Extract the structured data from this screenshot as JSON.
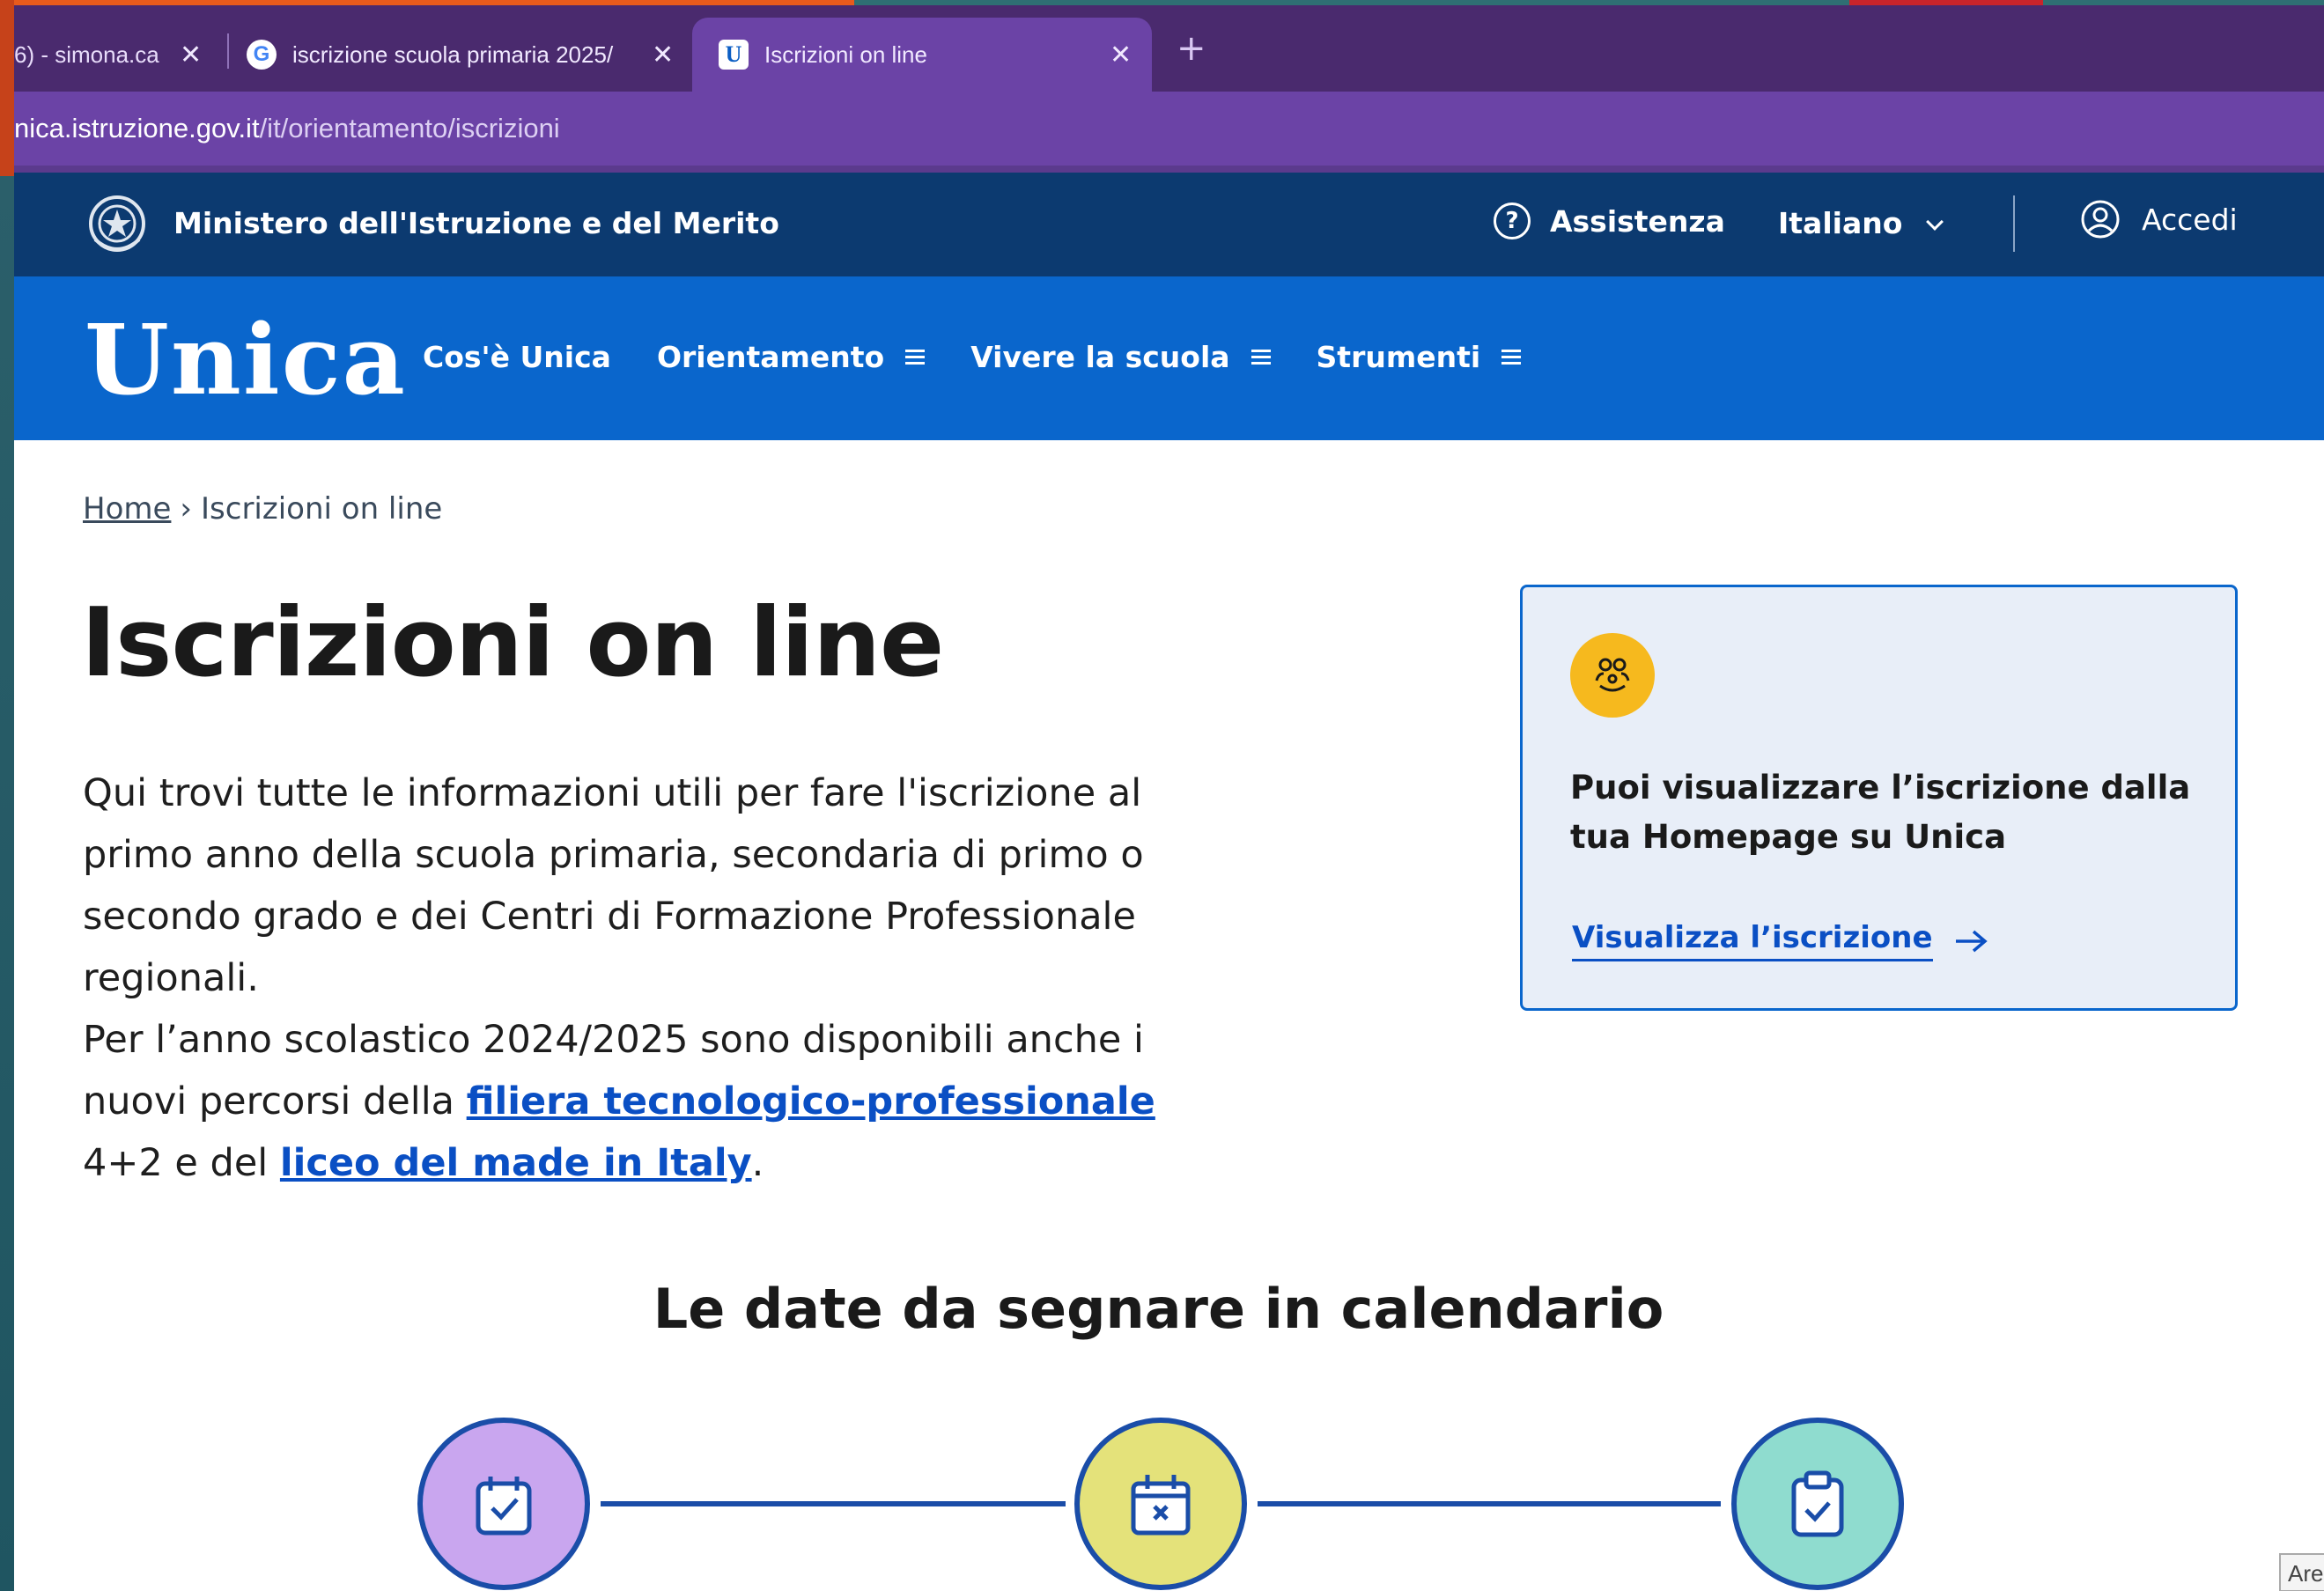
{
  "browser": {
    "tabs": [
      {
        "label": "6) - simona.ca",
        "icon": "mail-icon"
      },
      {
        "label": "iscrizione scuola primaria 2025/",
        "icon": "google-icon"
      },
      {
        "label": "Iscrizioni on line",
        "icon": "unica-icon",
        "active": true
      }
    ],
    "new_tab_symbol": "+",
    "close_symbol": "✕",
    "url_host": "nica.istruzione.gov.it",
    "url_path": "/it/orientamento/iscrizioni"
  },
  "header": {
    "ministry": "Ministero dell'Istruzione e del Merito",
    "assistance": "Assistenza",
    "language": "Italiano",
    "login": "Accedi"
  },
  "nav": {
    "logo": "Unica",
    "items": [
      {
        "label": "Cos'è Unica",
        "menu": false
      },
      {
        "label": "Orientamento",
        "menu": true
      },
      {
        "label": "Vivere la scuola",
        "menu": true
      },
      {
        "label": "Strumenti",
        "menu": true
      }
    ]
  },
  "breadcrumb": {
    "home": "Home",
    "separator": "›",
    "current": "Iscrizioni on line"
  },
  "page": {
    "title": "Iscrizioni on line",
    "intro_p1": "Qui trovi tutte le informazioni utili per fare l'iscrizione al primo anno della scuola primaria, secondaria di primo o secondo grado e dei Centri di Formazione Professionale regionali.",
    "intro_p2_a": "Per l’anno scolastico 2024/2025 sono disponibili anche i nuovi percorsi della ",
    "intro_link1": "filiera tecnologico-professionale",
    "intro_p2_b": " 4+2 e del ",
    "intro_link2": "liceo del made in Italy",
    "intro_p2_c": ".",
    "calendar_title": "Le date da segnare in calendario"
  },
  "card": {
    "icon": "family-icon",
    "title": "Puoi visualizzare l’iscrizione dalla tua Homepage su Unica",
    "link": "Visualizza l’iscrizione"
  },
  "timeline": [
    {
      "icon": "calendar-check-icon",
      "color": "#c9a6ef"
    },
    {
      "icon": "calendar-x-icon",
      "color": "#e4e27a"
    },
    {
      "icon": "clipboard-check-icon",
      "color": "#8fdccf"
    }
  ],
  "floating_label": "Are",
  "colors": {
    "tabbar": "#4a2a6e",
    "addressbar": "#6b43a6",
    "topbar": "#0c3a70",
    "navbar": "#0a66cc",
    "link": "#0a4fc4",
    "card_bg": "#e8eef8",
    "card_icon": "#f6b91e",
    "timeline": "#1a4da8"
  }
}
